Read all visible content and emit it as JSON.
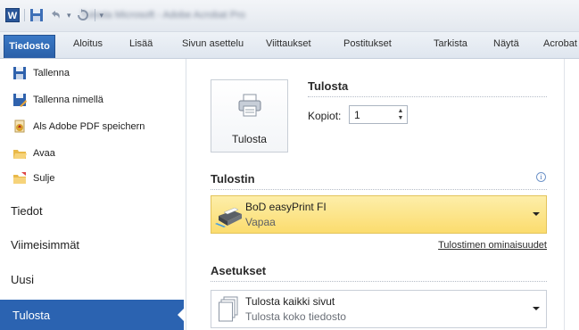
{
  "titlebar": {
    "logo_letter": "W",
    "title": "Tulosta Microsoft - Adobe Acrobat Pro"
  },
  "ribbon": {
    "file_tab": "Tiedosto",
    "tabs": [
      "Aloitus",
      "Lisää",
      "Sivun asettelu",
      "Viittaukset",
      "Postitukset",
      "Tarkista",
      "Näytä",
      "Acrobat"
    ]
  },
  "backstage": {
    "commands": [
      {
        "label": "Tallenna",
        "icon": "save-icon"
      },
      {
        "label": "Tallenna nimellä",
        "icon": "save-as-icon"
      },
      {
        "label": "Als Adobe PDF speichern",
        "icon": "adobe-pdf-icon"
      },
      {
        "label": "Avaa",
        "icon": "open-folder-icon"
      },
      {
        "label": "Sulje",
        "icon": "close-folder-icon"
      }
    ],
    "tabs": [
      "Tiedot",
      "Viimeisimmät",
      "Uusi"
    ],
    "active_tab": "Tulosta"
  },
  "print": {
    "heading": "Tulosta",
    "button_label": "Tulosta",
    "copies_label": "Kopiot:",
    "copies_value": "1",
    "printer_section": "Tulostin",
    "printer_name": "BoD easyPrint FI",
    "printer_status": "Vapaa",
    "printer_properties": "Tulostimen ominaisuudet",
    "settings_section": "Asetukset",
    "pages_option": "Tulosta kaikki sivut",
    "pages_option_desc": "Tulosta koko tiedosto"
  },
  "colors": {
    "file_tab": "#2a5fa8",
    "active_nav": "#2b63b1",
    "printer_highlight": "#fbdc6e"
  }
}
